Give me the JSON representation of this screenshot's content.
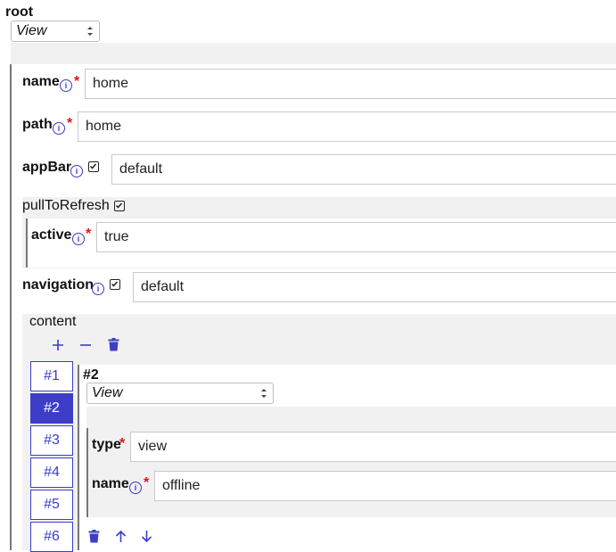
{
  "root": {
    "title": "root",
    "type_select": "View"
  },
  "fields": {
    "name": {
      "label": "name",
      "value": "home",
      "required_mark": "*"
    },
    "path": {
      "label": "path",
      "value": "home",
      "required_mark": "*"
    },
    "appBar": {
      "label": "appBar",
      "value": "default",
      "checked": true
    },
    "pullToRefresh": {
      "label": "pullToRefresh",
      "checked": true
    },
    "active": {
      "label": "active",
      "value": "true",
      "required_mark": "*"
    },
    "navigation": {
      "label": "navigation",
      "value": "default",
      "checked": true
    }
  },
  "info_glyph": "i",
  "content": {
    "label": "content",
    "tabs": [
      "#1",
      "#2",
      "#3",
      "#4",
      "#5",
      "#6"
    ],
    "active_tab": "#2",
    "item": {
      "title": "#2",
      "type_select": "View",
      "type": {
        "label": "type",
        "value": "view",
        "required_mark": "*"
      },
      "name": {
        "label": "name",
        "value": "offline",
        "required_mark": "*"
      }
    }
  },
  "icons": {
    "add": "plus-icon",
    "remove": "minus-icon",
    "delete": "trash-icon",
    "up": "arrow-up-icon",
    "down": "arrow-down-icon",
    "info": "info-icon",
    "checkbox": "checkbox-icon"
  },
  "colors": {
    "accent": "#3d3dc8",
    "required": "#e0141e",
    "panel": "#f1f1f1"
  }
}
